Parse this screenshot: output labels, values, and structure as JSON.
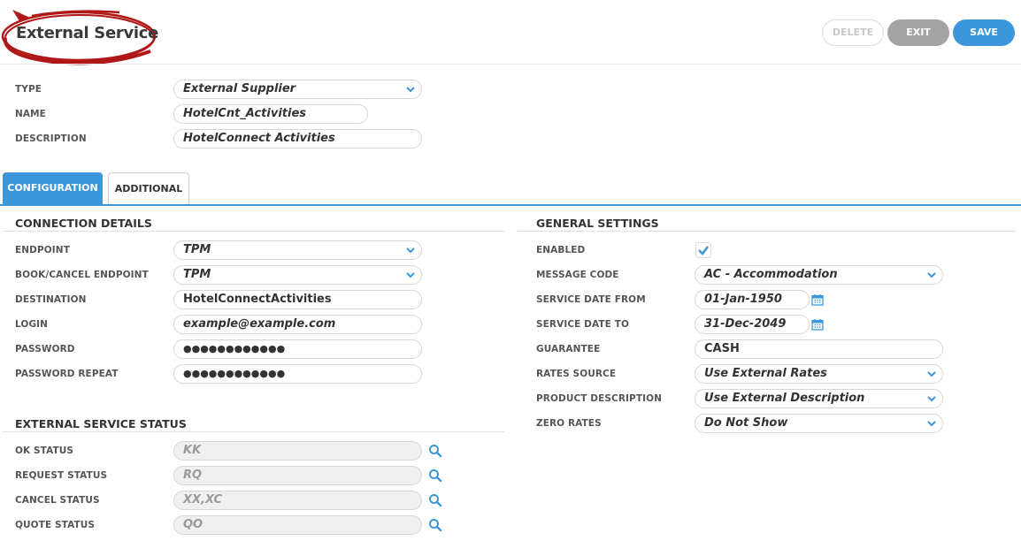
{
  "header": {
    "title": "External Service",
    "delete_label": "DELETE",
    "exit_label": "EXIT",
    "save_label": "SAVE"
  },
  "top_form": {
    "type_label": "TYPE",
    "type_value": "External Supplier",
    "name_label": "NAME",
    "name_value": "HotelCnt_Activities",
    "description_label": "DESCRIPTION",
    "description_value": "HotelConnect Activities"
  },
  "tabs": [
    {
      "label": "CONFIGURATION",
      "active": true
    },
    {
      "label": "ADDITIONAL",
      "active": false
    }
  ],
  "connection": {
    "title": "CONNECTION DETAILS",
    "endpoint_label": "ENDPOINT",
    "endpoint_value": "TPM",
    "book_cancel_label": "BOOK/CANCEL ENDPOINT",
    "book_cancel_value": "TPM",
    "destination_label": "DESTINATION",
    "destination_value": "HotelConnectActivities",
    "login_label": "LOGIN",
    "login_value": "example@example.com",
    "password_label": "PASSWORD",
    "password_value": "●●●●●●●●●●●●",
    "password_repeat_label": "PASSWORD REPEAT",
    "password_repeat_value": "●●●●●●●●●●●●"
  },
  "status": {
    "title": "EXTERNAL SERVICE STATUS",
    "ok_label": "OK STATUS",
    "ok_placeholder": "KK",
    "request_label": "REQUEST STATUS",
    "request_placeholder": "RQ",
    "cancel_label": "CANCEL STATUS",
    "cancel_placeholder": "XX,XC",
    "quote_label": "QUOTE STATUS",
    "quote_placeholder": "QO"
  },
  "general": {
    "title": "GENERAL SETTINGS",
    "enabled_label": "ENABLED",
    "enabled_checked": true,
    "message_code_label": "MESSAGE CODE",
    "message_code_value": "AC - Accommodation",
    "date_from_label": "SERVICE DATE FROM",
    "date_from_value": "01-Jan-1950",
    "date_to_label": "SERVICE DATE TO",
    "date_to_value": "31-Dec-2049",
    "guarantee_label": "GUARANTEE",
    "guarantee_value": "CASH",
    "rates_source_label": "RATES SOURCE",
    "rates_source_value": "Use External Rates",
    "product_desc_label": "PRODUCT DESCRIPTION",
    "product_desc_value": "Use External Description",
    "zero_rates_label": "ZERO RATES",
    "zero_rates_value": "Do Not Show"
  },
  "colors": {
    "accent": "#3b97d9",
    "annotation_red": "#b01717",
    "exit_gray": "#a3a3a3"
  },
  "icons": [
    "chevron-down-icon",
    "calendar-icon",
    "search-icon",
    "checkmark-icon"
  ]
}
